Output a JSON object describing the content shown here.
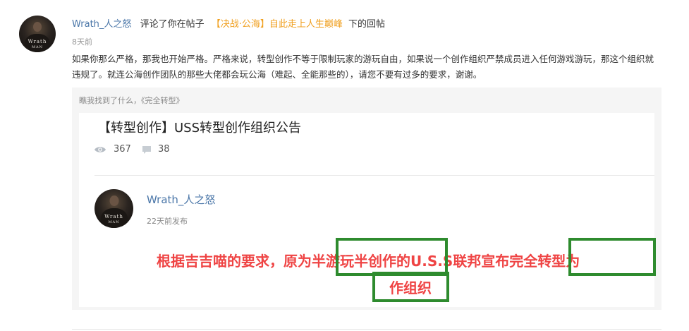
{
  "notification": {
    "username": "Wrath_人之怒",
    "action": "评论了你在帖子",
    "post_title": "【决战·公海】自此走上人生巅峰",
    "suffix": "下的回帖",
    "time": "8天前",
    "content": "如果你那么严格，那我也开始严格。严格来说，转型创作不等于限制玩家的游玩自由，如果说一个创作组织严禁成员进入任何游戏游玩，那这个组织就违规了。就连公海创作团队的那些大佬都会玩公海（难起、全能那些的），请您不要有过多的要求，谢谢。"
  },
  "quote": {
    "hint": "瞧我找到了什么，《完全转型》",
    "card": {
      "title": "【转型创作】USS转型创作组织公告",
      "views": "367",
      "comments": "38",
      "author": "Wrath_人之怒",
      "time": "22天前发布",
      "body_line1": "根据吉吉喵的要求，原为半游玩半创作的U.S.S联邦宣布完全转型为",
      "body_line2": "作组织"
    }
  },
  "avatar": {
    "text_top": "Wrath",
    "text_bottom": "MAN"
  },
  "icons": {
    "views": "eye-icon",
    "comments": "comment-icon"
  },
  "colors": {
    "username": "#4a76a8",
    "post_title": "#f0a020",
    "highlight_text": "#ef4444",
    "highlight_box": "#2e8b2e"
  }
}
